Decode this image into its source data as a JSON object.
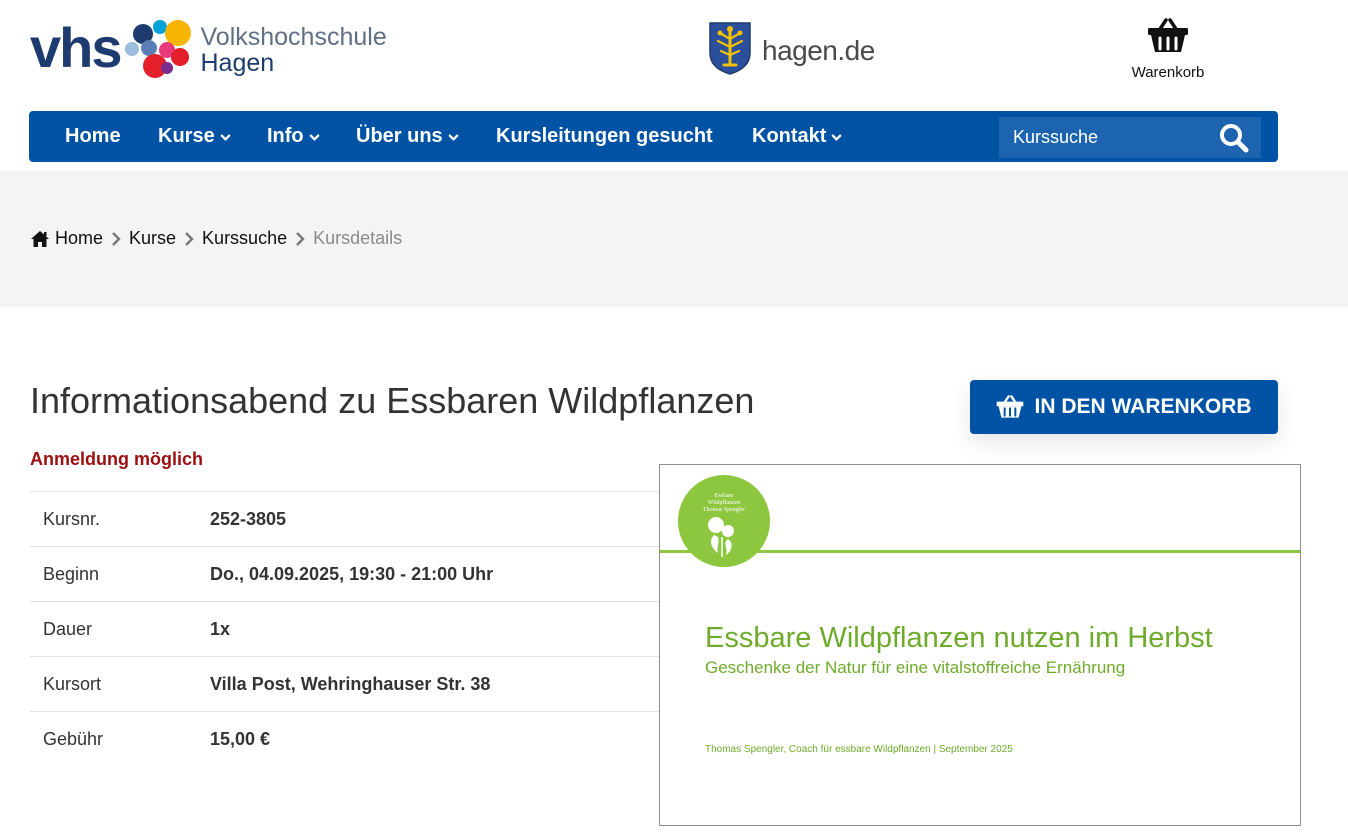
{
  "header": {
    "vhs_logo": {
      "mark": "vhs",
      "line1": "Volkshochschule",
      "line2": "Hagen"
    },
    "city_logo": {
      "text": "hagen.de",
      "icon": "city-crest-icon"
    },
    "cart": {
      "label": "Warenkorb",
      "icon": "basket-icon"
    }
  },
  "nav": {
    "items": [
      {
        "label": "Home",
        "has_dropdown": false
      },
      {
        "label": "Kurse",
        "has_dropdown": true
      },
      {
        "label": "Info",
        "has_dropdown": true
      },
      {
        "label": "Über uns",
        "has_dropdown": true
      },
      {
        "label": "Kursleitungen gesucht",
        "has_dropdown": false
      },
      {
        "label": "Kontakt",
        "has_dropdown": true
      }
    ],
    "search": {
      "placeholder": "Kurssuche",
      "icon": "search-icon"
    }
  },
  "breadcrumb": {
    "items": [
      "Home",
      "Kurse",
      "Kurssuche",
      "Kursdetails"
    ],
    "home_icon": "home-icon",
    "separator_icon": "chevron-right-icon"
  },
  "course": {
    "title": "Informationsabend zu Essbaren Wildpflanzen",
    "status": "Anmeldung möglich",
    "add_to_cart_label": "IN DEN WARENKORB",
    "details": [
      {
        "label": "Kursnr.",
        "value": "252-3805"
      },
      {
        "label": "Beginn",
        "value": "Do., 04.09.2025, 19:30 - 21:00 Uhr"
      },
      {
        "label": "Dauer",
        "value": "1x"
      },
      {
        "label": "Kursort",
        "value": "Villa Post, Wehringhauser Str. 38"
      },
      {
        "label": "Gebühr",
        "value": "15,00 €"
      }
    ]
  },
  "course_image": {
    "badge_lines": [
      "Essbare",
      "Wildpflanzen",
      "Thomas Spengler"
    ],
    "title": "Essbare Wildpflanzen nutzen im Herbst",
    "subtitle": "Geschenke der Natur für eine vitalstoffreiche Ernährung",
    "credit": "Thomas Spengler, Coach für essbare Wildpflanzen | September 2025"
  },
  "colors": {
    "primary_blue": "#0052a5",
    "search_blue": "#1c64b0",
    "status_red": "#9b0f0f",
    "slide_green": "#8dc63f",
    "band_gray": "#f4f4f4"
  }
}
